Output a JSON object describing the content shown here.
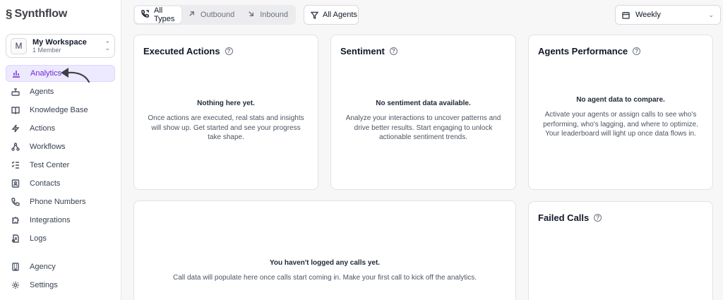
{
  "app": {
    "logo_text": "Synthflow"
  },
  "workspace": {
    "avatar_letter": "M",
    "name": "My Workspace",
    "members": "1 Member"
  },
  "sidebar": {
    "items": [
      {
        "label": "Analytics",
        "icon": "bar-chart-icon"
      },
      {
        "label": "Agents",
        "icon": "agent-icon"
      },
      {
        "label": "Knowledge Base",
        "icon": "book-icon"
      },
      {
        "label": "Actions",
        "icon": "lightning-icon"
      },
      {
        "label": "Workflows",
        "icon": "workflow-icon"
      },
      {
        "label": "Test Center",
        "icon": "checklist-icon"
      },
      {
        "label": "Contacts",
        "icon": "contact-card-icon"
      },
      {
        "label": "Phone Numbers",
        "icon": "phone-icon"
      },
      {
        "label": "Integrations",
        "icon": "puzzle-icon"
      },
      {
        "label": "Logs",
        "icon": "logs-icon"
      },
      {
        "label": "Agency",
        "icon": "building-icon"
      },
      {
        "label": "Settings",
        "icon": "gear-icon"
      }
    ]
  },
  "toolbar": {
    "tabs": [
      {
        "label": "All Types",
        "icon": "phone-arrows-icon"
      },
      {
        "label": "Outbound",
        "icon": "arrow-up-right-icon"
      },
      {
        "label": "Inbound",
        "icon": "arrow-down-right-icon"
      }
    ],
    "agents_filter": "All Agents",
    "period": "Weekly"
  },
  "cards": {
    "executed_actions": {
      "title": "Executed Actions",
      "empty_title": "Nothing here yet.",
      "empty_desc": "Once actions are executed, real stats and insights will show up. Get started and see your progress take shape."
    },
    "sentiment": {
      "title": "Sentiment",
      "empty_title": "No sentiment data available.",
      "empty_desc": "Analyze your interactions to uncover patterns and drive better results. Start engaging to unlock actionable sentiment trends."
    },
    "agents_performance": {
      "title": "Agents Performance",
      "empty_title": "No agent data to compare.",
      "empty_desc": "Activate your agents or assign calls to see who's performing, who's lagging, and where to optimize. Your leaderboard will light up once data flows in."
    },
    "calls": {
      "empty_title": "You haven't logged any calls yet.",
      "empty_desc": "Call data will populate here once calls start coming in. Make your first call to kick off the analytics."
    },
    "failed_calls": {
      "title": "Failed Calls"
    }
  },
  "colors": {
    "accent": "#6d28d9",
    "accent_bg": "#ede9fe"
  }
}
